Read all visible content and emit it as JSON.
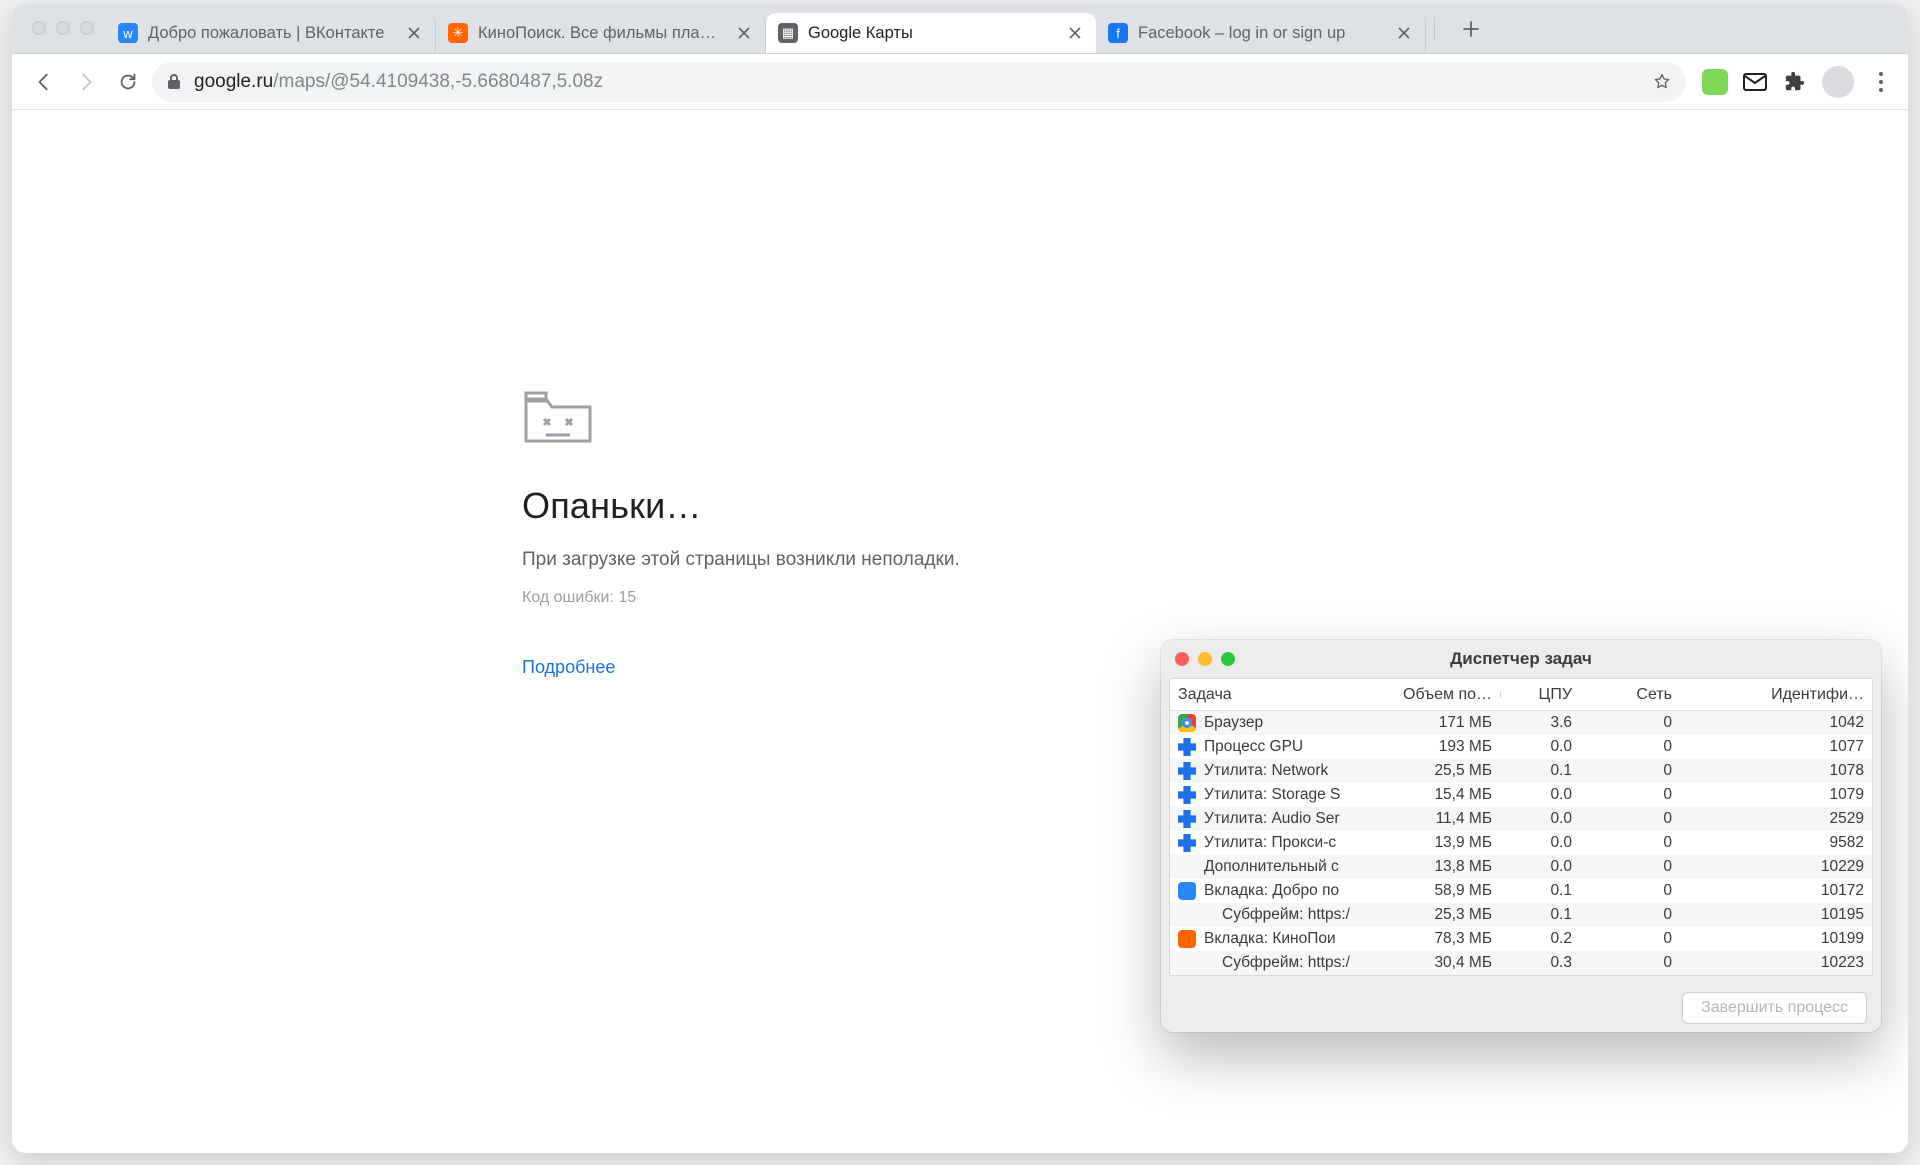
{
  "tabs": [
    {
      "favicon": "vk",
      "title": "Добро пожаловать | ВКонтакте",
      "active": false
    },
    {
      "favicon": "kp",
      "title": "КиноПоиск. Все фильмы планеты",
      "active": false
    },
    {
      "favicon": "gm",
      "title": "Google Карты",
      "active": true
    },
    {
      "favicon": "fb",
      "title": "Facebook – log in or sign up",
      "active": false
    }
  ],
  "omnibox": {
    "host": "google.ru",
    "path": "/maps/@54.4109438,-5.6680487,5.08z"
  },
  "error": {
    "title": "Опаньки…",
    "message": "При загрузке этой страницы возникли неполадки.",
    "code": "Код ошибки: 15",
    "link": "Подробнее"
  },
  "taskmgr": {
    "title": "Диспетчер задач",
    "columns": {
      "task": "Задача",
      "mem": "Объем по…",
      "cpu": "ЦПУ",
      "net": "Сеть",
      "id": "Идентифи…"
    },
    "end_process": "Завершить процесс",
    "rows": [
      {
        "icon": "chrome",
        "name": "Браузер",
        "mem": "171 МБ",
        "cpu": "3.6",
        "net": "0",
        "id": "1042"
      },
      {
        "icon": "ext",
        "name": "Процесс GPU",
        "mem": "193 МБ",
        "cpu": "0.0",
        "net": "0",
        "id": "1077"
      },
      {
        "icon": "ext",
        "name": "Утилита: Network",
        "mem": "25,5 МБ",
        "cpu": "0.1",
        "net": "0",
        "id": "1078"
      },
      {
        "icon": "ext",
        "name": "Утилита: Storage S",
        "mem": "15,4 МБ",
        "cpu": "0.0",
        "net": "0",
        "id": "1079"
      },
      {
        "icon": "ext",
        "name": "Утилита: Audio Ser",
        "mem": "11,4 МБ",
        "cpu": "0.0",
        "net": "0",
        "id": "2529"
      },
      {
        "icon": "ext",
        "name": "Утилита: Прокси-с",
        "mem": "13,9 МБ",
        "cpu": "0.0",
        "net": "0",
        "id": "9582"
      },
      {
        "icon": "",
        "name": "Дополнительный с",
        "mem": "13,8 МБ",
        "cpu": "0.0",
        "net": "0",
        "id": "10229"
      },
      {
        "icon": "vk",
        "name": "Вкладка: Добро по",
        "mem": "58,9 МБ",
        "cpu": "0.1",
        "net": "0",
        "id": "10172"
      },
      {
        "icon": "",
        "name": "Субфрейм: https:/",
        "indent": true,
        "mem": "25,3 МБ",
        "cpu": "0.1",
        "net": "0",
        "id": "10195"
      },
      {
        "icon": "kp",
        "name": "Вкладка: КиноПои",
        "mem": "78,3 МБ",
        "cpu": "0.2",
        "net": "0",
        "id": "10199"
      },
      {
        "icon": "",
        "name": "Субфрейм: https:/",
        "indent": true,
        "mem": "30,4 МБ",
        "cpu": "0.3",
        "net": "0",
        "id": "10223"
      }
    ]
  }
}
